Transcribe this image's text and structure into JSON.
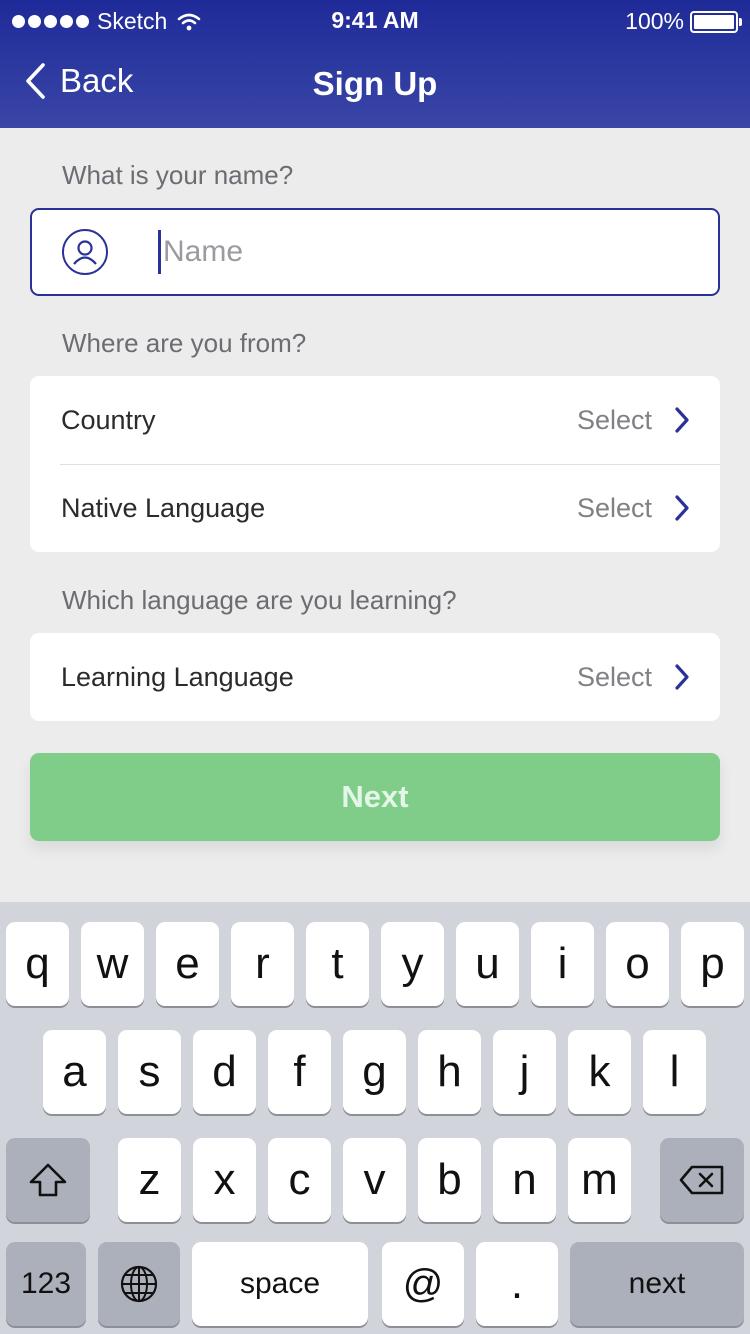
{
  "status_bar": {
    "carrier": "Sketch",
    "time": "9:41 AM",
    "battery": "100%",
    "battery_level": 1.0
  },
  "nav": {
    "back_label": "Back",
    "title": "Sign Up"
  },
  "name_section": {
    "label": "What is your name?",
    "placeholder": "Name",
    "value": ""
  },
  "origin_section": {
    "label": "Where are you from?",
    "rows": [
      {
        "label": "Country",
        "value": "Select"
      },
      {
        "label": "Native Language",
        "value": "Select"
      }
    ]
  },
  "learning_section": {
    "label": "Which language are you learning?",
    "rows": [
      {
        "label": "Learning Language",
        "value": "Select"
      }
    ]
  },
  "next_button": {
    "label": "Next",
    "color": "#80cd8a"
  },
  "keyboard": {
    "row1": [
      "q",
      "w",
      "e",
      "r",
      "t",
      "y",
      "u",
      "i",
      "o",
      "p"
    ],
    "row2": [
      "a",
      "s",
      "d",
      "f",
      "g",
      "h",
      "j",
      "k",
      "l"
    ],
    "row3": [
      "z",
      "x",
      "c",
      "v",
      "b",
      "n",
      "m"
    ],
    "numbers_label": "123",
    "space_label": "space",
    "at_label": "@",
    "period_label": ".",
    "return_label": "next",
    "icons": {
      "shift": "shift-icon",
      "delete": "delete-icon",
      "globe": "globe-icon"
    }
  },
  "colors": {
    "header": "#2d3aa0",
    "accent": "#2a3297",
    "background": "#ececed"
  }
}
